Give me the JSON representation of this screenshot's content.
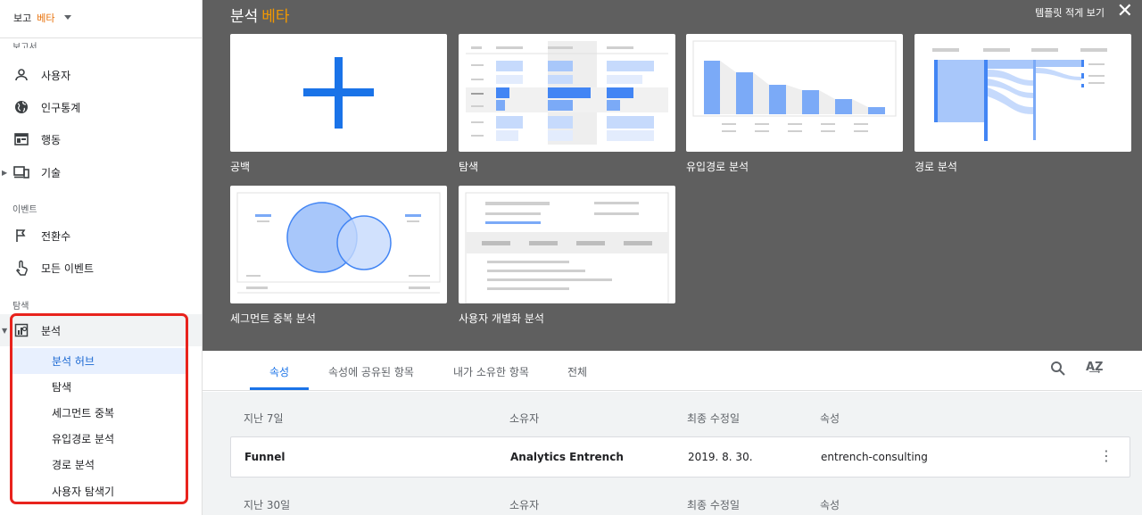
{
  "sidebar": {
    "top_label": "보고",
    "top_beta": "베타",
    "section_reports": "보고서",
    "items": [
      {
        "label": "사용자"
      },
      {
        "label": "인구통계"
      },
      {
        "label": "행동"
      },
      {
        "label": "기술"
      }
    ],
    "section_events": "이벤트",
    "event_items": [
      {
        "label": "전환수"
      },
      {
        "label": "모든 이벤트"
      }
    ],
    "section_explore": "탐색",
    "analysis_label": "분석",
    "analysis_sub": [
      {
        "label": "분석 허브"
      },
      {
        "label": "탐색"
      },
      {
        "label": "세그먼트 중복"
      },
      {
        "label": "유입경로 분석"
      },
      {
        "label": "경로 분석"
      },
      {
        "label": "사용자 탐색기"
      }
    ]
  },
  "gallery": {
    "title": "분석",
    "title_beta": "베타",
    "collapse_link": "템플릿 적게 보기",
    "templates": [
      {
        "label": "공백"
      },
      {
        "label": "탐색"
      },
      {
        "label": "유입경로 분석"
      },
      {
        "label": "경로 분석"
      },
      {
        "label": "세그먼트 중복 분석"
      },
      {
        "label": "사용자 개별화 분석"
      }
    ]
  },
  "tabs": [
    {
      "label": "속성"
    },
    {
      "label": "속성에 공유된 항목"
    },
    {
      "label": "내가 소유한 항목"
    },
    {
      "label": "전체"
    }
  ],
  "list": {
    "groups": [
      {
        "period": "지난 7일",
        "owner_col": "소유자",
        "modified_col": "최종 수정일",
        "property_col": "속성"
      },
      {
        "period": "지난 30일",
        "owner_col": "소유자",
        "modified_col": "최종 수정일",
        "property_col": "속성"
      }
    ],
    "rows": [
      {
        "name": "Funnel",
        "owner": "Analytics Entrench",
        "modified": "2019. 8. 30.",
        "property": "entrench-consulting"
      }
    ]
  },
  "colors": {
    "accent": "#1a73e8",
    "beta": "#e8710a",
    "gallery_bg": "#5f5f5f",
    "highlight": "#e8231d"
  }
}
